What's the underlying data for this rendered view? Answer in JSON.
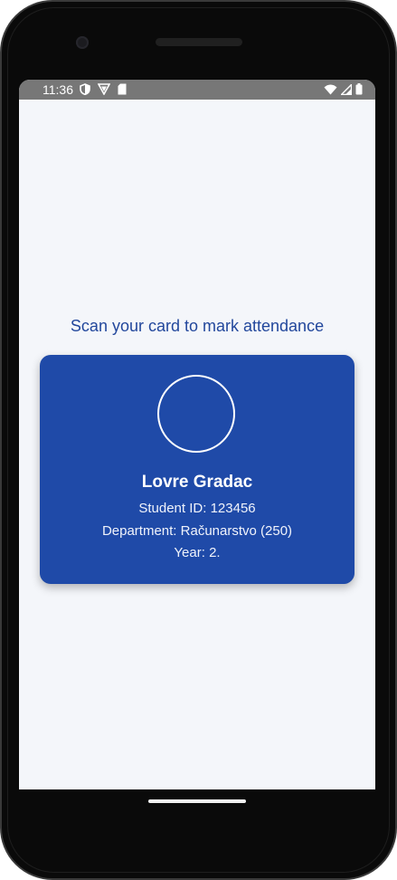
{
  "status_bar": {
    "time": "11:36",
    "left_icons": [
      "shield-icon",
      "vpn-icon",
      "sd-card-icon"
    ],
    "right_icons": [
      "wifi-icon",
      "cell-signal-icon",
      "battery-icon"
    ]
  },
  "main": {
    "headline": "Scan your card to mark attendance",
    "card": {
      "name": "Lovre Gradac",
      "student_id": "Student ID: 123456",
      "department": "Department: Računarstvo (250)",
      "year": "Year: 2."
    }
  },
  "colors": {
    "card_background": "#1f4aa8",
    "headline_text": "#22479c",
    "screen_background": "#f4f6fa",
    "status_bar": "#777777"
  }
}
